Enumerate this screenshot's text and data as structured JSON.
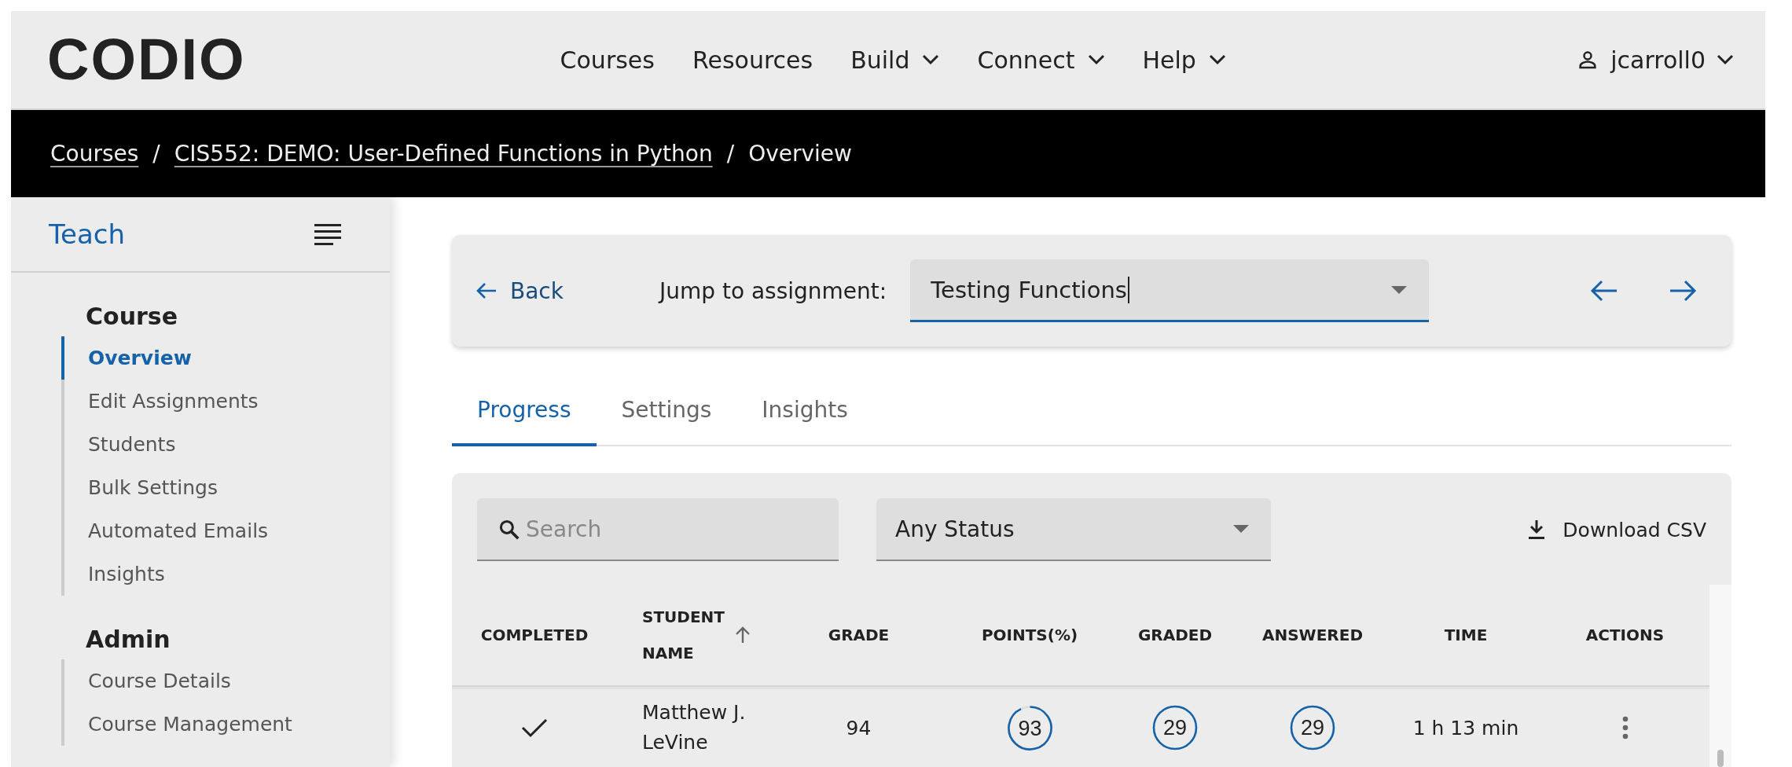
{
  "header": {
    "logo": "CODIO",
    "nav": [
      {
        "label": "Courses",
        "has_menu": false
      },
      {
        "label": "Resources",
        "has_menu": false
      },
      {
        "label": "Build",
        "has_menu": true
      },
      {
        "label": "Connect",
        "has_menu": true
      },
      {
        "label": "Help",
        "has_menu": true
      }
    ],
    "user": {
      "name": "jcarroll0",
      "has_menu": true
    }
  },
  "breadcrumb": [
    {
      "kind": "link",
      "label": "Courses"
    },
    {
      "kind": "separator",
      "label": "/"
    },
    {
      "kind": "link",
      "label": "CIS552: DEMO: User-Defined Functions in Python"
    },
    {
      "kind": "separator",
      "label": "/"
    },
    {
      "kind": "current",
      "label": "Overview"
    }
  ],
  "sidebar": {
    "title": "Teach",
    "sections": [
      {
        "heading": "Course",
        "items": [
          {
            "label": "Overview",
            "selected": true
          },
          {
            "label": "Edit Assignments",
            "selected": false
          },
          {
            "label": "Students",
            "selected": false
          },
          {
            "label": "Bulk Settings",
            "selected": false
          },
          {
            "label": "Automated Emails",
            "selected": false
          },
          {
            "label": "Insights",
            "selected": false
          }
        ]
      },
      {
        "heading": "Admin",
        "items": [
          {
            "label": "Course Details",
            "selected": false
          },
          {
            "label": "Course Management",
            "selected": false
          }
        ]
      }
    ]
  },
  "assignment_bar": {
    "back": "Back",
    "jump_label": "Jump to assignment:",
    "value": "Testing Functions"
  },
  "tabs": [
    {
      "label": "Progress",
      "selected": true
    },
    {
      "label": "Settings",
      "selected": false
    },
    {
      "label": "Insights",
      "selected": false
    }
  ],
  "filters": {
    "search_placeholder": "Search",
    "status": "Any Status",
    "download": "Download CSV"
  },
  "table": {
    "columns": [
      {
        "label": "COMPLETED",
        "sorted": false
      },
      {
        "label": "STUDENT NAME",
        "sorted": true
      },
      {
        "label": "GRADE",
        "sorted": false
      },
      {
        "label": "POINTS(%)",
        "sorted": false
      },
      {
        "label": "GRADED",
        "sorted": false
      },
      {
        "label": "ANSWERED",
        "sorted": false
      },
      {
        "label": "TIME",
        "sorted": false
      },
      {
        "label": "ACTIONS",
        "sorted": false
      }
    ],
    "rows": [
      {
        "completed": true,
        "student": "Matthew J. LeVine",
        "grade": "94",
        "points": {
          "value": "93",
          "level": 0.93
        },
        "graded": "29",
        "answered": "29",
        "time": "1 h 13 min"
      }
    ]
  }
}
